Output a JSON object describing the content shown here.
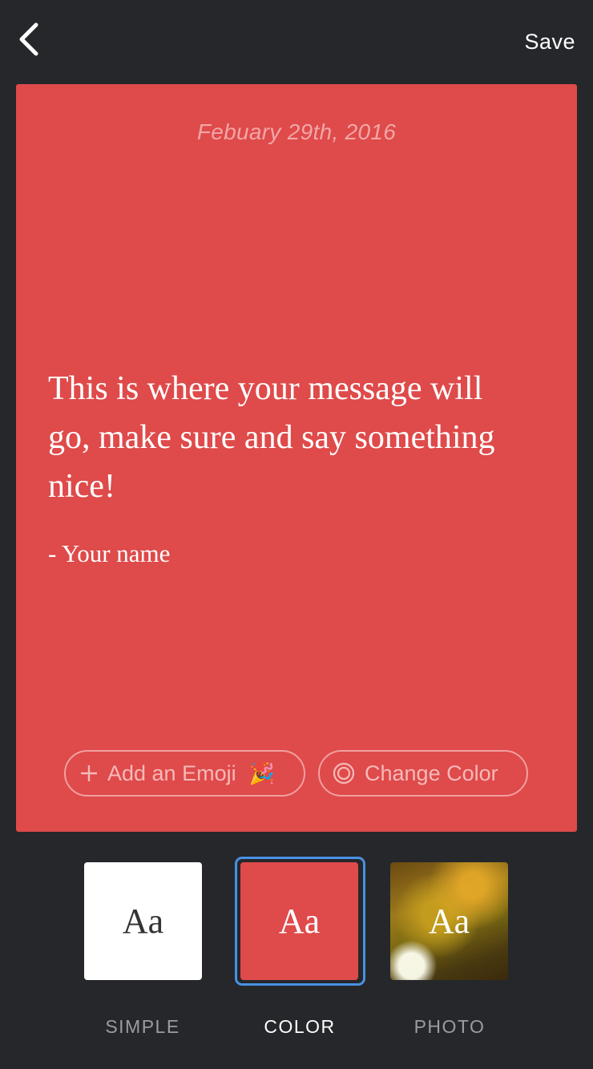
{
  "header": {
    "back_icon": "chevron-left-icon",
    "save_label": "Save"
  },
  "card": {
    "background": "#df4a4a",
    "date": "Febuary 29th, 2016",
    "message": "This is where your message will go, make sure and say something nice!",
    "signature": "- Your name",
    "add_emoji_label": "Add an Emoji",
    "add_emoji_icon": "plus-icon",
    "emoji_glyph": "🎉",
    "change_color_label": "Change Color",
    "change_color_icon": "color-ring-icon"
  },
  "styles": {
    "selected": "COLOR",
    "options": [
      {
        "preview": "Aa",
        "label": "SIMPLE"
      },
      {
        "preview": "Aa",
        "label": "COLOR"
      },
      {
        "preview": "Aa",
        "label": "PHOTO"
      }
    ]
  },
  "colors": {
    "background": "#25272b",
    "accent_red": "#df4a4a",
    "selection_blue": "#4a90e2"
  }
}
